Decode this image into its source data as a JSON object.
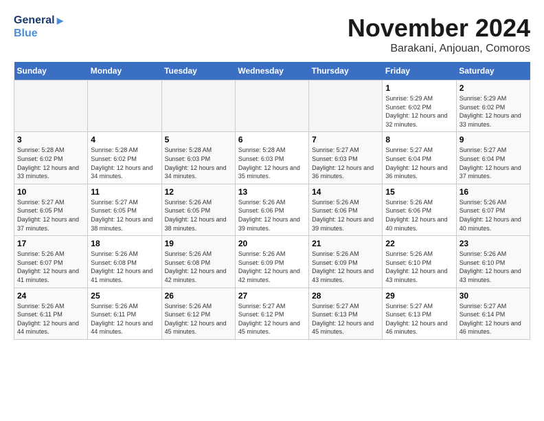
{
  "header": {
    "logo_line1": "General",
    "logo_line2": "Blue",
    "month": "November 2024",
    "location": "Barakani, Anjouan, Comoros"
  },
  "days_of_week": [
    "Sunday",
    "Monday",
    "Tuesday",
    "Wednesday",
    "Thursday",
    "Friday",
    "Saturday"
  ],
  "weeks": [
    [
      {
        "date": "",
        "info": ""
      },
      {
        "date": "",
        "info": ""
      },
      {
        "date": "",
        "info": ""
      },
      {
        "date": "",
        "info": ""
      },
      {
        "date": "",
        "info": ""
      },
      {
        "date": "1",
        "info": "Sunrise: 5:29 AM\nSunset: 6:02 PM\nDaylight: 12 hours and 32 minutes."
      },
      {
        "date": "2",
        "info": "Sunrise: 5:29 AM\nSunset: 6:02 PM\nDaylight: 12 hours and 33 minutes."
      }
    ],
    [
      {
        "date": "3",
        "info": "Sunrise: 5:28 AM\nSunset: 6:02 PM\nDaylight: 12 hours and 33 minutes."
      },
      {
        "date": "4",
        "info": "Sunrise: 5:28 AM\nSunset: 6:02 PM\nDaylight: 12 hours and 34 minutes."
      },
      {
        "date": "5",
        "info": "Sunrise: 5:28 AM\nSunset: 6:03 PM\nDaylight: 12 hours and 34 minutes."
      },
      {
        "date": "6",
        "info": "Sunrise: 5:28 AM\nSunset: 6:03 PM\nDaylight: 12 hours and 35 minutes."
      },
      {
        "date": "7",
        "info": "Sunrise: 5:27 AM\nSunset: 6:03 PM\nDaylight: 12 hours and 36 minutes."
      },
      {
        "date": "8",
        "info": "Sunrise: 5:27 AM\nSunset: 6:04 PM\nDaylight: 12 hours and 36 minutes."
      },
      {
        "date": "9",
        "info": "Sunrise: 5:27 AM\nSunset: 6:04 PM\nDaylight: 12 hours and 37 minutes."
      }
    ],
    [
      {
        "date": "10",
        "info": "Sunrise: 5:27 AM\nSunset: 6:05 PM\nDaylight: 12 hours and 37 minutes."
      },
      {
        "date": "11",
        "info": "Sunrise: 5:27 AM\nSunset: 6:05 PM\nDaylight: 12 hours and 38 minutes."
      },
      {
        "date": "12",
        "info": "Sunrise: 5:26 AM\nSunset: 6:05 PM\nDaylight: 12 hours and 38 minutes."
      },
      {
        "date": "13",
        "info": "Sunrise: 5:26 AM\nSunset: 6:06 PM\nDaylight: 12 hours and 39 minutes."
      },
      {
        "date": "14",
        "info": "Sunrise: 5:26 AM\nSunset: 6:06 PM\nDaylight: 12 hours and 39 minutes."
      },
      {
        "date": "15",
        "info": "Sunrise: 5:26 AM\nSunset: 6:06 PM\nDaylight: 12 hours and 40 minutes."
      },
      {
        "date": "16",
        "info": "Sunrise: 5:26 AM\nSunset: 6:07 PM\nDaylight: 12 hours and 40 minutes."
      }
    ],
    [
      {
        "date": "17",
        "info": "Sunrise: 5:26 AM\nSunset: 6:07 PM\nDaylight: 12 hours and 41 minutes."
      },
      {
        "date": "18",
        "info": "Sunrise: 5:26 AM\nSunset: 6:08 PM\nDaylight: 12 hours and 41 minutes."
      },
      {
        "date": "19",
        "info": "Sunrise: 5:26 AM\nSunset: 6:08 PM\nDaylight: 12 hours and 42 minutes."
      },
      {
        "date": "20",
        "info": "Sunrise: 5:26 AM\nSunset: 6:09 PM\nDaylight: 12 hours and 42 minutes."
      },
      {
        "date": "21",
        "info": "Sunrise: 5:26 AM\nSunset: 6:09 PM\nDaylight: 12 hours and 43 minutes."
      },
      {
        "date": "22",
        "info": "Sunrise: 5:26 AM\nSunset: 6:10 PM\nDaylight: 12 hours and 43 minutes."
      },
      {
        "date": "23",
        "info": "Sunrise: 5:26 AM\nSunset: 6:10 PM\nDaylight: 12 hours and 43 minutes."
      }
    ],
    [
      {
        "date": "24",
        "info": "Sunrise: 5:26 AM\nSunset: 6:11 PM\nDaylight: 12 hours and 44 minutes."
      },
      {
        "date": "25",
        "info": "Sunrise: 5:26 AM\nSunset: 6:11 PM\nDaylight: 12 hours and 44 minutes."
      },
      {
        "date": "26",
        "info": "Sunrise: 5:26 AM\nSunset: 6:12 PM\nDaylight: 12 hours and 45 minutes."
      },
      {
        "date": "27",
        "info": "Sunrise: 5:27 AM\nSunset: 6:12 PM\nDaylight: 12 hours and 45 minutes."
      },
      {
        "date": "28",
        "info": "Sunrise: 5:27 AM\nSunset: 6:13 PM\nDaylight: 12 hours and 45 minutes."
      },
      {
        "date": "29",
        "info": "Sunrise: 5:27 AM\nSunset: 6:13 PM\nDaylight: 12 hours and 46 minutes."
      },
      {
        "date": "30",
        "info": "Sunrise: 5:27 AM\nSunset: 6:14 PM\nDaylight: 12 hours and 46 minutes."
      }
    ]
  ]
}
